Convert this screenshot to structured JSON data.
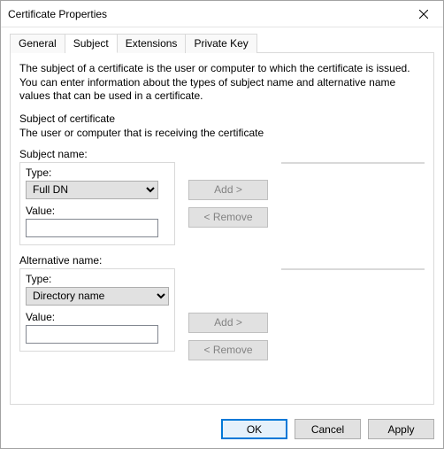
{
  "window": {
    "title": "Certificate Properties"
  },
  "tabs": {
    "items": [
      {
        "label": "General"
      },
      {
        "label": "Subject"
      },
      {
        "label": "Extensions"
      },
      {
        "label": "Private Key"
      }
    ],
    "active_index": 1
  },
  "panel": {
    "intro": "The subject of a certificate is the user or computer to which the certificate is issued. You can enter information about the types of subject name and alternative name values that can be used in a certificate.",
    "section_title": "Subject of certificate",
    "section_desc": "The user or computer that is receiving the certificate",
    "subject": {
      "heading": "Subject name:",
      "type_label": "Type:",
      "type_value": "Full DN",
      "value_label": "Value:",
      "value_value": "",
      "add_label": "Add >",
      "remove_label": "< Remove"
    },
    "alt": {
      "heading": "Alternative name:",
      "type_label": "Type:",
      "type_value": "Directory name",
      "value_label": "Value:",
      "value_value": "",
      "add_label": "Add >",
      "remove_label": "< Remove"
    }
  },
  "buttons": {
    "ok": "OK",
    "cancel": "Cancel",
    "apply": "Apply"
  }
}
